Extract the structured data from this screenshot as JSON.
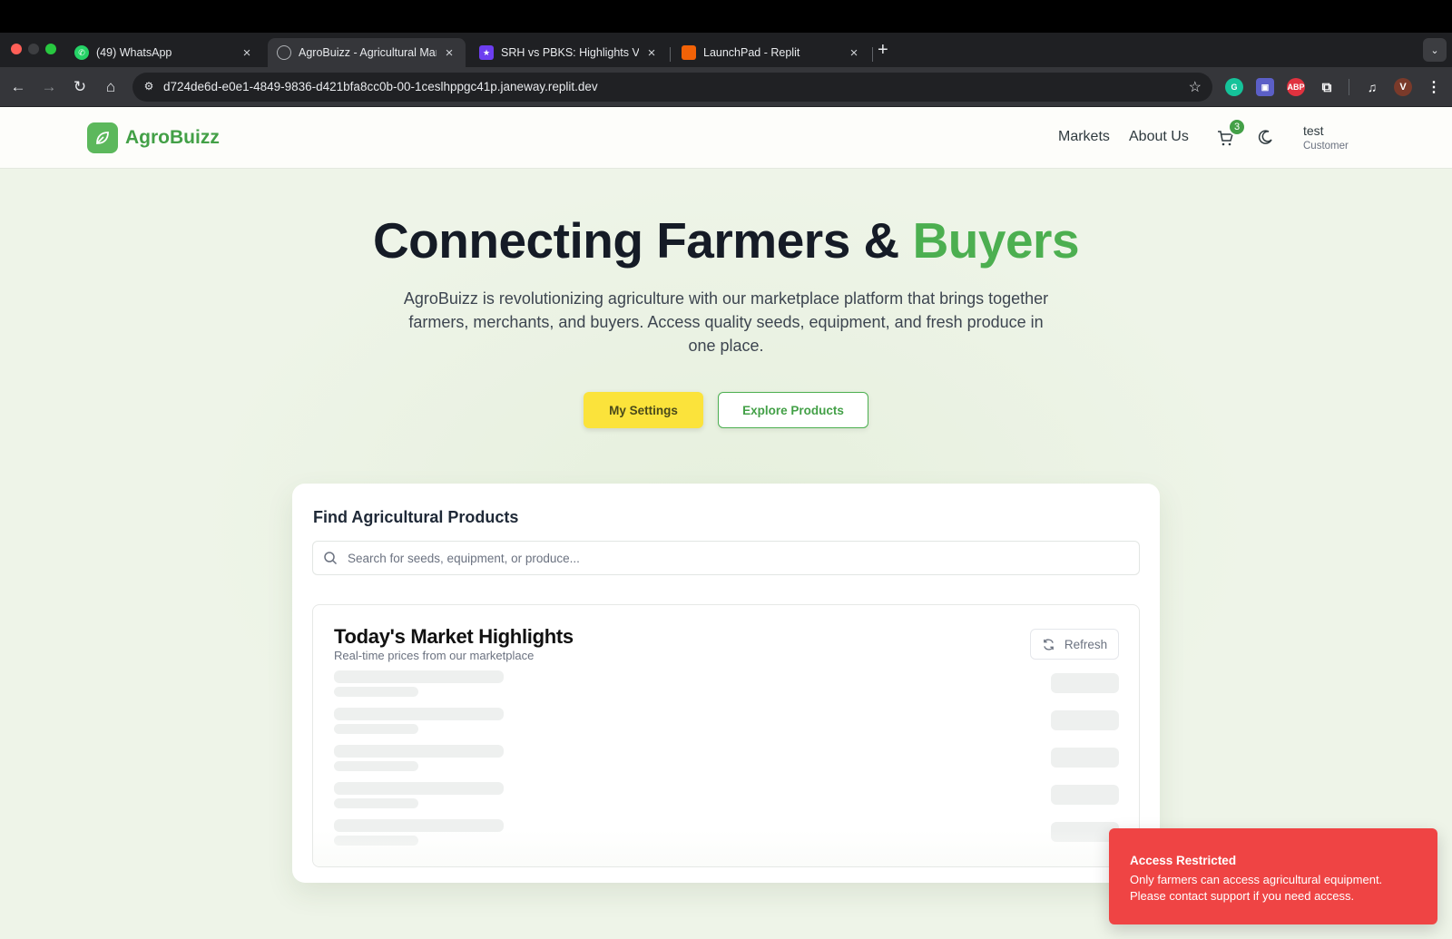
{
  "browser": {
    "tabs": [
      {
        "title": "(49) WhatsApp",
        "active": false
      },
      {
        "title": "AgroBuizz - Agricultural Mark",
        "active": true
      },
      {
        "title": "SRH vs PBKS: Highlights Vide",
        "active": false
      },
      {
        "title": "LaunchPad - Replit",
        "active": false
      }
    ],
    "new_tab": "+",
    "url": "d724de6d-e0e1-4849-9836-d421bfa8cc0b-00-1ceslhppgc41p.janeway.replit.dev",
    "profile_initial": "V",
    "ext_abp": "ABP"
  },
  "nav": {
    "brand": "AgroBuizz",
    "links": [
      "Markets",
      "About Us"
    ],
    "cart_count": "3",
    "user": {
      "name": "test",
      "role": "Customer"
    }
  },
  "hero": {
    "title_main": "Connecting Farmers & ",
    "title_accent": "Buyers",
    "subtitle": "AgroBuizz is revolutionizing agriculture with our marketplace platform that brings together farmers, merchants, and buyers. Access quality seeds, equipment, and fresh produce in one place.",
    "primary_button": "My Settings",
    "secondary_button": "Explore Products"
  },
  "finder": {
    "title": "Find Agricultural Products",
    "search_placeholder": "Search for seeds, equipment, or produce..."
  },
  "market": {
    "title": "Today's Market Highlights",
    "subtitle": "Real-time prices from our marketplace",
    "refresh_label": "Refresh",
    "loading_rows": 5
  },
  "toast": {
    "title": "Access Restricted",
    "message": "Only farmers can access agricultural equipment. Please contact support if you need access."
  },
  "colors": {
    "brand_green": "#43a047",
    "accent_yellow": "#fbe33b",
    "error_red": "#ef4444"
  }
}
